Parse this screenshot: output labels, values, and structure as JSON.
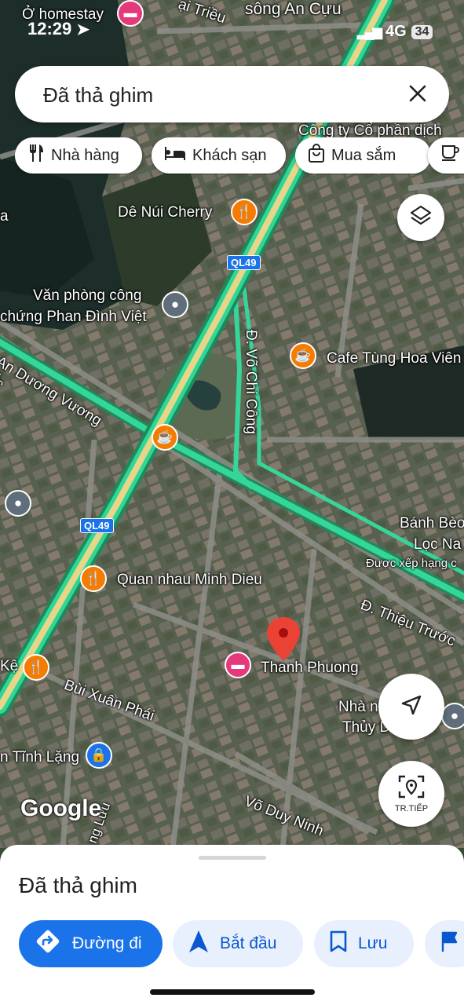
{
  "status_bar": {
    "back_app": "Ở homestay",
    "time": "12:29",
    "network": "4G",
    "battery": "34"
  },
  "search": {
    "query": "Đã thả ghim"
  },
  "chips": [
    {
      "label": "Nhà hàng",
      "icon": "fork-knife-icon"
    },
    {
      "label": "Khách sạn",
      "icon": "bed-icon"
    },
    {
      "label": "Mua sắm",
      "icon": "shopping-bag-icon"
    },
    {
      "label": "",
      "icon": "coffee-icon"
    }
  ],
  "map": {
    "labels": {
      "song_an_cuu": "sông An Cựu",
      "dai_trieu": "ại Triều",
      "cong_ty": "Công ty Cổ phần dịch",
      "de_nui": "Dê Núi Cherry",
      "ql49_a": "QL49",
      "ql49_b": "QL49",
      "van_phong_1": "Văn phòng công",
      "van_phong_2": "chứng Phan Đình Việt",
      "an_duong_vuong": "An Dương Vương",
      "vo_chi_cong": "Đ. Võ Chí Công",
      "cafe_tung": "Cafe Tùng Hoa Viên",
      "banh_beo_1": "Bánh Bèo",
      "banh_beo_2": "Lọc Na",
      "duoc_xep": "Được xếp hạng c",
      "quan_nhau": "Quan nhau Minh Dieu",
      "thieu_tuoc": "Đ. Thiệu Trước",
      "thanh_phuong": "Thanh Phuong",
      "bui_xuan_phai": "Bùi Xuân Phái",
      "nha_1": "Nhà n",
      "nha_2": "Thủy D",
      "ke": "Kệ",
      "tinh_lang": "n Tĩnh Lặng",
      "vo_duy_ninh": "Võ Duy Ninh",
      "tung_luu": "ng Lưu",
      "left_a": "a",
      "tuoc": "ớc",
      "google": "Google"
    },
    "recenter_label": "TR.TIẾP"
  },
  "sheet": {
    "title": "Đã thả ghim",
    "buttons": [
      {
        "label": "Đường đi",
        "icon": "directions-icon"
      },
      {
        "label": "Bắt đầu",
        "icon": "navigation-arrow-icon"
      },
      {
        "label": "Lưu",
        "icon": "bookmark-icon"
      },
      {
        "label": "",
        "icon": "flag-icon"
      }
    ]
  },
  "colors": {
    "accent": "#1a73e8",
    "chip_blue": "#e8f0fe",
    "pin_red": "#ea4335",
    "food_orange": "#f57c00",
    "hotel_pink": "#e5397c",
    "road_green": "#2ecc8f"
  }
}
